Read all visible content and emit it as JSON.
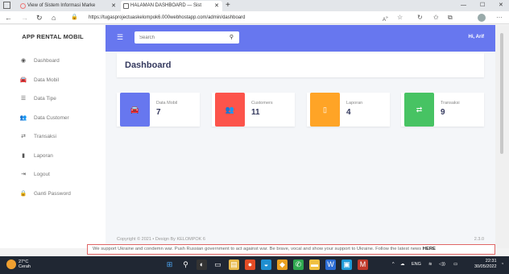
{
  "browser": {
    "tabs": [
      {
        "label": "View of Sistem Informasi Marke"
      },
      {
        "label": "HALAMAN DASHBOARD — Sist"
      }
    ],
    "url": "https://tugasprojectuaskelompok6.000webhostapp.com/admin/dashboard"
  },
  "sidebar": {
    "brand": "APP RENTAL MOBIL",
    "items": [
      {
        "label": "Dashboard",
        "icon": "palette-icon"
      },
      {
        "label": "Data Mobil",
        "icon": "car-icon"
      },
      {
        "label": "Data Tipe",
        "icon": "list-icon"
      },
      {
        "label": "Data Customer",
        "icon": "users-icon"
      },
      {
        "label": "Transaksi",
        "icon": "shuffle-icon"
      },
      {
        "label": "Laporan",
        "icon": "file-icon"
      },
      {
        "label": "Logout",
        "icon": "logout-icon"
      },
      {
        "label": "Ganti Password",
        "icon": "lock-icon"
      }
    ]
  },
  "topbar": {
    "search_placeholder": "Search",
    "user": "Hi, Arif"
  },
  "main": {
    "title": "Dashboard",
    "stats": [
      {
        "label": "Data Mobil",
        "value": "7",
        "color": "#6777ef",
        "icon": "car-icon"
      },
      {
        "label": "Customers",
        "value": "11",
        "color": "#fc544b",
        "icon": "users-icon"
      },
      {
        "label": "Laporan",
        "value": "4",
        "color": "#ffa426",
        "icon": "file-icon"
      },
      {
        "label": "Transaksi",
        "value": "9",
        "color": "#47c363",
        "icon": "shuffle-icon"
      }
    ],
    "footer": "Copyright © 2021 • Design By KELOMPOK 6",
    "version": "2.3.0"
  },
  "banner": {
    "text": "We support Ukraine and condemn war. Push Russian government to act against war. Be brave, vocal and show your support to Ukraine. Follow the latest news",
    "link": "HERE"
  },
  "taskbar": {
    "temp": "27°C",
    "weather": "Cerah",
    "lang": "ENG",
    "time": "22:31",
    "date": "30/05/2022"
  }
}
